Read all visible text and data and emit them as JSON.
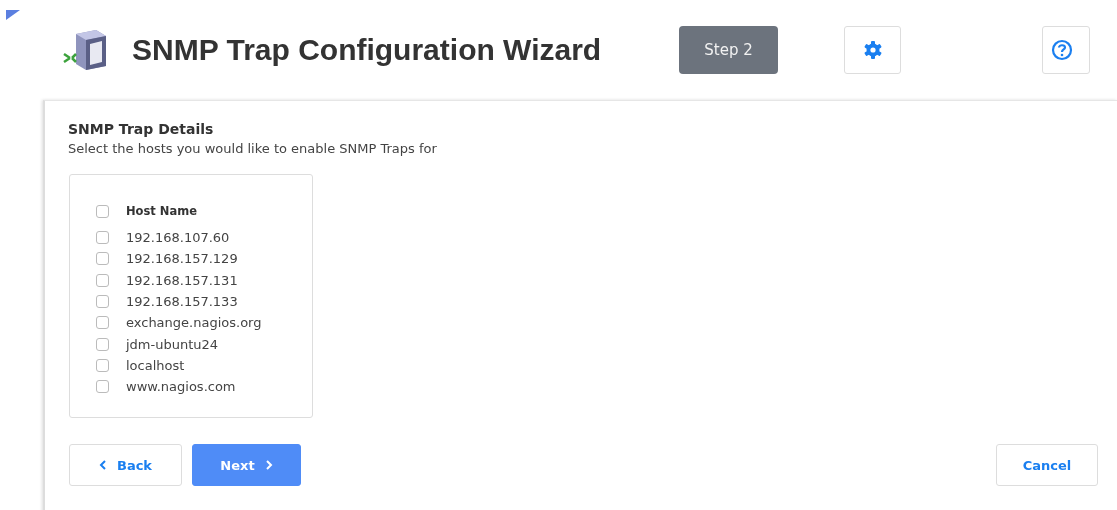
{
  "header": {
    "title": "SNMP Trap Configuration Wizard",
    "step": "Step 2"
  },
  "section": {
    "title": "SNMP Trap Details",
    "description": "Select the hosts you would like to enable SNMP Traps for"
  },
  "host_table": {
    "header": {
      "label": "Host Name",
      "checked": false
    },
    "hosts": [
      {
        "name": "192.168.107.60",
        "checked": false
      },
      {
        "name": "192.168.157.129",
        "checked": false
      },
      {
        "name": "192.168.157.131",
        "checked": false
      },
      {
        "name": "192.168.157.133",
        "checked": false
      },
      {
        "name": "exchange.nagios.org",
        "checked": false
      },
      {
        "name": "jdm-ubuntu24",
        "checked": false
      },
      {
        "name": "localhost",
        "checked": false
      },
      {
        "name": "www.nagios.com",
        "checked": false
      }
    ]
  },
  "buttons": {
    "back": "Back",
    "next": "Next",
    "cancel": "Cancel"
  }
}
